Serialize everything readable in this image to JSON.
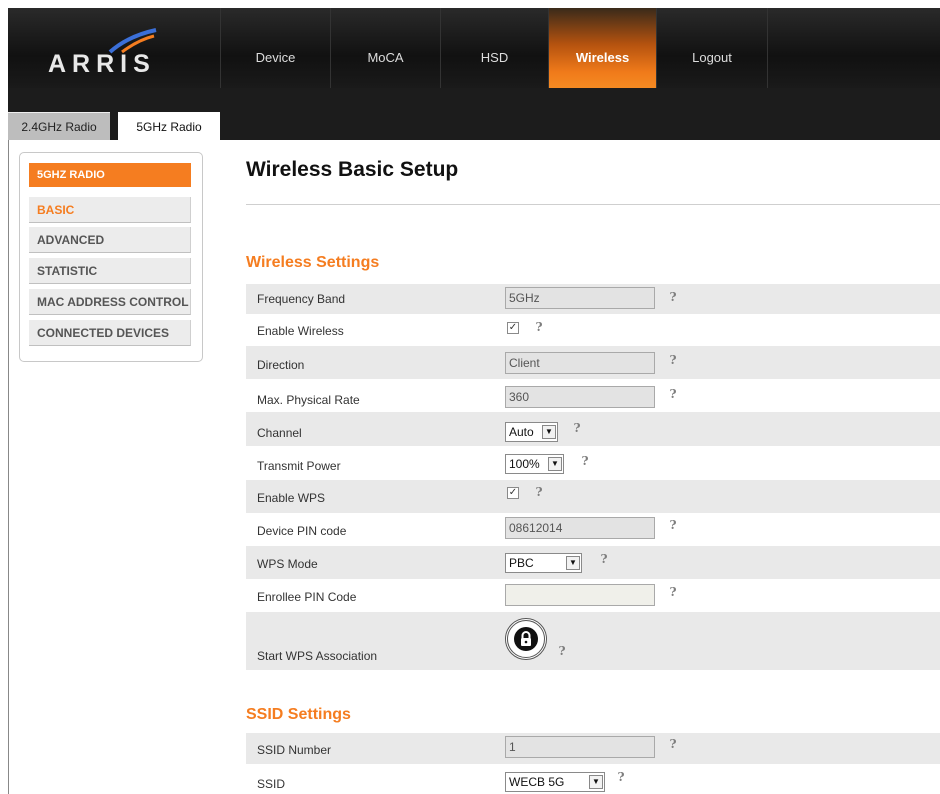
{
  "brand": {
    "logo_text": "ARRIS"
  },
  "nav": [
    {
      "label": "Device",
      "active": false
    },
    {
      "label": "MoCA",
      "active": false
    },
    {
      "label": "HSD",
      "active": false
    },
    {
      "label": "Wireless",
      "active": true
    },
    {
      "label": "Logout",
      "active": false
    }
  ],
  "tabs": [
    {
      "label": "2.4GHz Radio",
      "active": false
    },
    {
      "label": "5GHz Radio",
      "active": true
    }
  ],
  "sidebar": {
    "header": "5GHZ RADIO",
    "items": [
      {
        "label": "BASIC",
        "active": true
      },
      {
        "label": "ADVANCED",
        "active": false
      },
      {
        "label": "STATISTIC",
        "active": false
      },
      {
        "label": "MAC ADDRESS CONTROL",
        "active": false
      },
      {
        "label": "CONNECTED DEVICES",
        "active": false
      }
    ]
  },
  "page": {
    "title": "Wireless Basic Setup"
  },
  "wireless_settings": {
    "title": "Wireless Settings",
    "help_glyph": "?",
    "frequency_band": {
      "label": "Frequency Band",
      "value": "5GHz"
    },
    "enable_wireless": {
      "label": "Enable Wireless",
      "checked": true,
      "check_glyph": "✓"
    },
    "direction": {
      "label": "Direction",
      "value": "Client"
    },
    "max_physical_rate": {
      "label": "Max. Physical Rate",
      "value": "360"
    },
    "channel": {
      "label": "Channel",
      "value": "Auto"
    },
    "transmit_power": {
      "label": "Transmit Power",
      "value": "100%"
    },
    "enable_wps": {
      "label": "Enable WPS",
      "checked": true,
      "check_glyph": "✓"
    },
    "device_pin": {
      "label": "Device PIN code",
      "value": "08612014"
    },
    "wps_mode": {
      "label": "WPS Mode",
      "value": "PBC"
    },
    "enrollee_pin": {
      "label": "Enrollee PIN Code",
      "value": ""
    },
    "start_wps": {
      "label": "Start WPS Association"
    }
  },
  "ssid_settings": {
    "title": "SSID Settings",
    "ssid_number": {
      "label": "SSID Number",
      "value": "1"
    },
    "ssid": {
      "label": "SSID",
      "value": "WECB 5G"
    }
  },
  "colors": {
    "accent": "#f57d20",
    "header_bg": "#1a1a1a",
    "row_shade": "#e9e9e9"
  },
  "icons": {
    "help": "help-icon",
    "dropdown": "chevron-down-icon",
    "lock": "lock-icon"
  }
}
